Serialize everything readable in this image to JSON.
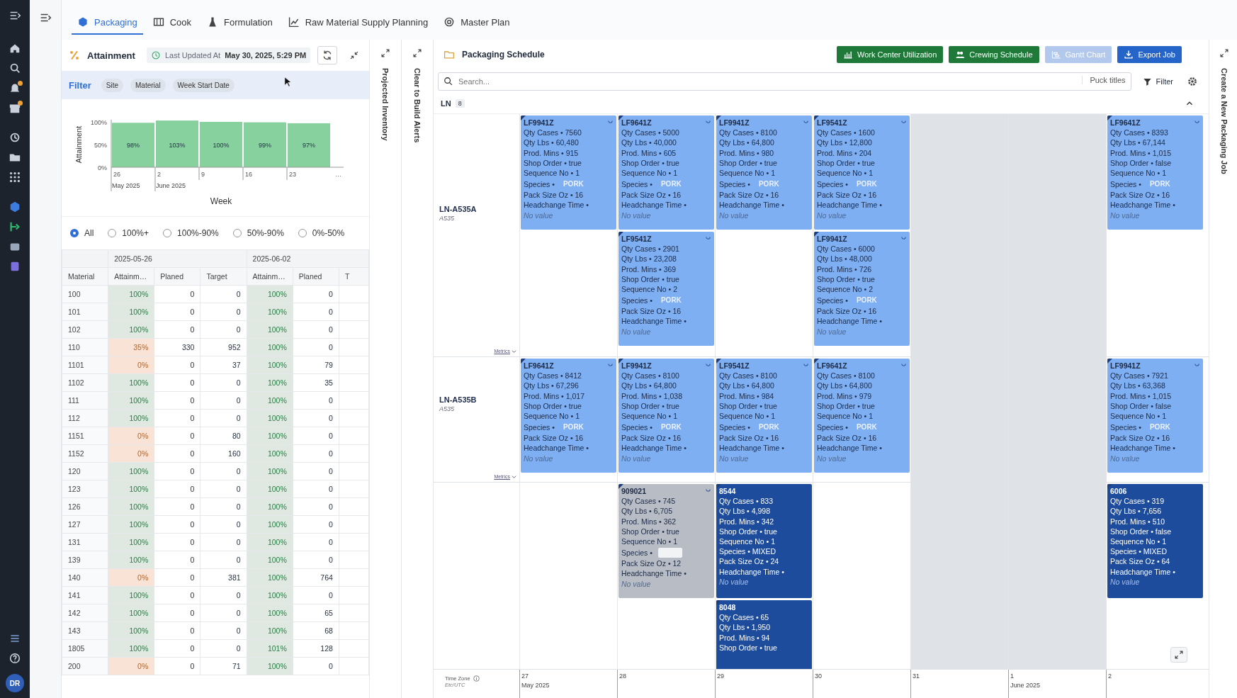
{
  "rail": [
    {
      "badge": false
    },
    {
      "badge": false
    },
    {
      "badge": false
    },
    {
      "badge": true
    },
    {
      "badge": true
    },
    {
      "badge": false
    },
    {
      "badge": false
    },
    {
      "badge": false
    },
    {
      "badge": false
    },
    {
      "badge": false
    },
    {
      "badge": false
    },
    {
      "badge": false
    }
  ],
  "avatar": "DR",
  "tabs": [
    {
      "label": "Packaging",
      "selected": true
    },
    {
      "label": "Cook",
      "selected": false
    },
    {
      "label": "Formulation",
      "selected": false
    },
    {
      "label": "Raw Material Supply Planning",
      "selected": false
    },
    {
      "label": "Master Plan",
      "selected": false
    }
  ],
  "attainment": {
    "title": "Attainment",
    "updated_label": "Last Updated At",
    "updated_value": "May 30, 2025, 5:29 PM",
    "filter": {
      "label": "Filter",
      "chips": [
        "Site",
        "Material",
        "Week Start Date"
      ]
    },
    "chart": {
      "month_labels": [
        "May 2025",
        "June 2025"
      ],
      "more_label": "…",
      "chart_data": {
        "type": "bar",
        "xlabel": "Week",
        "ylabel": "Attainment",
        "categories": [
          "26",
          "2",
          "9",
          "16",
          "23"
        ],
        "values": [
          98,
          103,
          100,
          99,
          97
        ],
        "ylim": [
          0,
          105
        ],
        "yticks": [
          {
            "value": 0,
            "label": "0%"
          },
          {
            "value": 50,
            "label": "50%"
          },
          {
            "value": 100,
            "label": "100%"
          }
        ],
        "data_labels": true,
        "value_labels": [
          "98%",
          "103%",
          "100%",
          "99%",
          "97%"
        ]
      }
    },
    "ranges": [
      {
        "label": "All",
        "selected": true
      },
      {
        "label": "100%+",
        "selected": false
      },
      {
        "label": "100%-90%",
        "selected": false
      },
      {
        "label": "50%-90%",
        "selected": false
      },
      {
        "label": "0%-50%",
        "selected": false
      }
    ],
    "table": {
      "week_headers": [
        "2025-05-26",
        "2025-06-02"
      ],
      "columns": [
        "Material",
        "Attainm…",
        "Planed",
        "Target",
        "Attainm…",
        "Planed",
        "T"
      ],
      "rows": [
        {
          "material": "100",
          "weeks": [
            {
              "attainment": "100%",
              "low": false,
              "planned": "0",
              "target": "0"
            },
            {
              "attainment": "100%",
              "low": false,
              "planned": "0"
            }
          ]
        },
        {
          "material": "101",
          "weeks": [
            {
              "attainment": "100%",
              "low": false,
              "planned": "0",
              "target": "0"
            },
            {
              "attainment": "100%",
              "low": false,
              "planned": "0"
            }
          ]
        },
        {
          "material": "102",
          "weeks": [
            {
              "attainment": "100%",
              "low": false,
              "planned": "0",
              "target": "0"
            },
            {
              "attainment": "100%",
              "low": false,
              "planned": "0"
            }
          ]
        },
        {
          "material": "110",
          "weeks": [
            {
              "attainment": "35%",
              "low": true,
              "planned": "330",
              "target": "952"
            },
            {
              "attainment": "100%",
              "low": false,
              "planned": "0"
            }
          ]
        },
        {
          "material": "1101",
          "weeks": [
            {
              "attainment": "0%",
              "low": true,
              "planned": "0",
              "target": "37"
            },
            {
              "attainment": "100%",
              "low": false,
              "planned": "79"
            }
          ]
        },
        {
          "material": "1102",
          "weeks": [
            {
              "attainment": "100%",
              "low": false,
              "planned": "0",
              "target": "0"
            },
            {
              "attainment": "100%",
              "low": false,
              "planned": "35"
            }
          ]
        },
        {
          "material": "111",
          "weeks": [
            {
              "attainment": "100%",
              "low": false,
              "planned": "0",
              "target": "0"
            },
            {
              "attainment": "100%",
              "low": false,
              "planned": "0"
            }
          ]
        },
        {
          "material": "112",
          "weeks": [
            {
              "attainment": "100%",
              "low": false,
              "planned": "0",
              "target": "0"
            },
            {
              "attainment": "100%",
              "low": false,
              "planned": "0"
            }
          ]
        },
        {
          "material": "1151",
          "weeks": [
            {
              "attainment": "0%",
              "low": true,
              "planned": "0",
              "target": "80"
            },
            {
              "attainment": "100%",
              "low": false,
              "planned": "0"
            }
          ]
        },
        {
          "material": "1152",
          "weeks": [
            {
              "attainment": "0%",
              "low": true,
              "planned": "0",
              "target": "160"
            },
            {
              "attainment": "100%",
              "low": false,
              "planned": "0"
            }
          ]
        },
        {
          "material": "120",
          "weeks": [
            {
              "attainment": "100%",
              "low": false,
              "planned": "0",
              "target": "0"
            },
            {
              "attainment": "100%",
              "low": false,
              "planned": "0"
            }
          ]
        },
        {
          "material": "123",
          "weeks": [
            {
              "attainment": "100%",
              "low": false,
              "planned": "0",
              "target": "0"
            },
            {
              "attainment": "100%",
              "low": false,
              "planned": "0"
            }
          ]
        },
        {
          "material": "126",
          "weeks": [
            {
              "attainment": "100%",
              "low": false,
              "planned": "0",
              "target": "0"
            },
            {
              "attainment": "100%",
              "low": false,
              "planned": "0"
            }
          ]
        },
        {
          "material": "127",
          "weeks": [
            {
              "attainment": "100%",
              "low": false,
              "planned": "0",
              "target": "0"
            },
            {
              "attainment": "100%",
              "low": false,
              "planned": "0"
            }
          ]
        },
        {
          "material": "131",
          "weeks": [
            {
              "attainment": "100%",
              "low": false,
              "planned": "0",
              "target": "0"
            },
            {
              "attainment": "100%",
              "low": false,
              "planned": "0"
            }
          ]
        },
        {
          "material": "139",
          "weeks": [
            {
              "attainment": "100%",
              "low": false,
              "planned": "0",
              "target": "0"
            },
            {
              "attainment": "100%",
              "low": false,
              "planned": "0"
            }
          ]
        },
        {
          "material": "140",
          "weeks": [
            {
              "attainment": "0%",
              "low": true,
              "planned": "0",
              "target": "381"
            },
            {
              "attainment": "100%",
              "low": false,
              "planned": "764"
            }
          ]
        },
        {
          "material": "141",
          "weeks": [
            {
              "attainment": "100%",
              "low": false,
              "planned": "0",
              "target": "0"
            },
            {
              "attainment": "100%",
              "low": false,
              "planned": "0"
            }
          ]
        },
        {
          "material": "142",
          "weeks": [
            {
              "attainment": "100%",
              "low": false,
              "planned": "0",
              "target": "0"
            },
            {
              "attainment": "100%",
              "low": false,
              "planned": "65"
            }
          ]
        },
        {
          "material": "143",
          "weeks": [
            {
              "attainment": "100%",
              "low": false,
              "planned": "0",
              "target": "0"
            },
            {
              "attainment": "100%",
              "low": false,
              "planned": "68"
            }
          ]
        },
        {
          "material": "1805",
          "weeks": [
            {
              "attainment": "100%",
              "low": false,
              "planned": "0",
              "target": "0"
            },
            {
              "attainment": "101%",
              "low": false,
              "planned": "128"
            }
          ]
        },
        {
          "material": "200",
          "weeks": [
            {
              "attainment": "0%",
              "low": true,
              "planned": "0",
              "target": "71"
            },
            {
              "attainment": "100%",
              "low": false,
              "planned": "0"
            }
          ]
        }
      ]
    }
  },
  "side_panels": [
    "Projected Inventory",
    "Clear to Build Alerts"
  ],
  "create_panel": "Create a New Packaging Job",
  "schedule": {
    "title": "Packaging Schedule",
    "buttons": [
      {
        "label": "Work Center Utilization",
        "kind": "green",
        "disabled": false
      },
      {
        "label": "Crewing Schedule",
        "kind": "green",
        "disabled": false
      },
      {
        "label": "Gantt Chart",
        "kind": "blue",
        "disabled": true
      },
      {
        "label": "Export Job",
        "kind": "blue",
        "disabled": false
      }
    ],
    "search": {
      "placeholder": "Search..."
    },
    "puck_titles": "Puck titles",
    "filter": "Filter",
    "group": {
      "label": "LN",
      "count": "8",
      "expanded": true
    },
    "lanes": [
      {
        "name": "LN-A535A",
        "code": "A535",
        "metrics": "Metrics",
        "columns": [
          {
            "nonworking": false,
            "cards": [
              {
                "kind": "light",
                "title": "LF9941Z",
                "fields": [
                  "Qty Cases • 7560",
                  "Qty Lbs • 60,480",
                  "Prod. Mins • 915",
                  "Shop Order • true",
                  "Sequence No • 1"
                ],
                "species": {
                  "label": "Species •",
                  "value": "PORK",
                  "tag": true
                },
                "pack_size": "Pack Size Oz • 16",
                "headchange": "Headchange Time •",
                "note": "No value"
              }
            ]
          },
          {
            "nonworking": false,
            "cards": [
              {
                "kind": "light",
                "title": "LF9641Z",
                "fields": [
                  "Qty Cases • 5000",
                  "Qty Lbs • 40,000",
                  "Prod. Mins • 605",
                  "Shop Order • true",
                  "Sequence No • 1"
                ],
                "species": {
                  "label": "Species •",
                  "value": "PORK",
                  "tag": true
                },
                "pack_size": "Pack Size Oz • 16",
                "headchange": "Headchange Time •",
                "note": "No value"
              },
              {
                "kind": "light",
                "title": "LF9541Z",
                "fields": [
                  "Qty Cases • 2901",
                  "Qty Lbs • 23,208",
                  "Prod. Mins • 369",
                  "Shop Order • true",
                  "Sequence No • 2"
                ],
                "species": {
                  "label": "Species •",
                  "value": "PORK",
                  "tag": true
                },
                "pack_size": "Pack Size Oz • 16",
                "headchange": "Headchange Time •",
                "note": "No value"
              }
            ]
          },
          {
            "nonworking": false,
            "cards": [
              {
                "kind": "light",
                "title": "LF9941Z",
                "fields": [
                  "Qty Cases • 8100",
                  "Qty Lbs • 64,800",
                  "Prod. Mins • 980",
                  "Shop Order • true",
                  "Sequence No • 1"
                ],
                "species": {
                  "label": "Species •",
                  "value": "PORK",
                  "tag": true
                },
                "pack_size": "Pack Size Oz • 16",
                "headchange": "Headchange Time •",
                "note": "No value"
              }
            ]
          },
          {
            "nonworking": false,
            "cards": [
              {
                "kind": "light",
                "title": "LF9541Z",
                "fields": [
                  "Qty Cases • 1600",
                  "Qty Lbs • 12,800",
                  "Prod. Mins • 204",
                  "Shop Order • true",
                  "Sequence No • 1"
                ],
                "species": {
                  "label": "Species •",
                  "value": "PORK",
                  "tag": true
                },
                "pack_size": "Pack Size Oz • 16",
                "headchange": "Headchange Time •",
                "note": "No value"
              },
              {
                "kind": "light",
                "title": "LF9941Z",
                "fields": [
                  "Qty Cases • 6000",
                  "Qty Lbs • 48,000",
                  "Prod. Mins • 726",
                  "Shop Order • true",
                  "Sequence No • 2"
                ],
                "species": {
                  "label": "Species •",
                  "value": "PORK",
                  "tag": true
                },
                "pack_size": "Pack Size Oz • 16",
                "headchange": "Headchange Time •",
                "note": "No value"
              }
            ]
          },
          {
            "nonworking": true
          },
          {
            "nonworking": true
          },
          {
            "nonworking": false,
            "cards": [
              {
                "kind": "light",
                "title": "LF9641Z",
                "fields": [
                  "Qty Cases • 8393",
                  "Qty Lbs • 67,144",
                  "Prod. Mins • 1,015",
                  "Shop Order • false",
                  "Sequence No • 1"
                ],
                "species": {
                  "label": "Species •",
                  "value": "PORK",
                  "tag": true
                },
                "pack_size": "Pack Size Oz • 16",
                "headchange": "Headchange Time •",
                "note": "No value"
              }
            ]
          }
        ]
      },
      {
        "name": "LN-A535B",
        "code": "A535",
        "metrics": "Metrics",
        "columns": [
          {
            "nonworking": false,
            "cards": [
              {
                "kind": "light",
                "title": "LF9641Z",
                "fields": [
                  "Qty Cases • 8412",
                  "Qty Lbs • 67,296",
                  "Prod. Mins • 1,017",
                  "Shop Order • true",
                  "Sequence No • 1"
                ],
                "species": {
                  "label": "Species •",
                  "value": "PORK",
                  "tag": true
                },
                "pack_size": "Pack Size Oz • 16",
                "headchange": "Headchange Time •",
                "note": "No value"
              }
            ]
          },
          {
            "nonworking": false,
            "cards": [
              {
                "kind": "light",
                "title": "LF9941Z",
                "fields": [
                  "Qty Cases • 8100",
                  "Qty Lbs • 64,800",
                  "Prod. Mins • 1,038",
                  "Shop Order • true",
                  "Sequence No • 1"
                ],
                "species": {
                  "label": "Species •",
                  "value": "PORK",
                  "tag": true
                },
                "pack_size": "Pack Size Oz • 16",
                "headchange": "Headchange Time •",
                "note": "No value"
              }
            ]
          },
          {
            "nonworking": false,
            "cards": [
              {
                "kind": "light",
                "title": "LF9541Z",
                "fields": [
                  "Qty Cases • 8100",
                  "Qty Lbs • 64,800",
                  "Prod. Mins • 984",
                  "Shop Order • true",
                  "Sequence No • 1"
                ],
                "species": {
                  "label": "Species •",
                  "value": "PORK",
                  "tag": true
                },
                "pack_size": "Pack Size Oz • 16",
                "headchange": "Headchange Time •",
                "note": "No value"
              }
            ]
          },
          {
            "nonworking": false,
            "cards": [
              {
                "kind": "light",
                "title": "LF9641Z",
                "fields": [
                  "Qty Cases • 8100",
                  "Qty Lbs • 64,800",
                  "Prod. Mins • 979",
                  "Shop Order • true",
                  "Sequence No • 1"
                ],
                "species": {
                  "label": "Species •",
                  "value": "PORK",
                  "tag": true
                },
                "pack_size": "Pack Size Oz • 16",
                "headchange": "Headchange Time •",
                "note": "No value"
              }
            ]
          },
          {
            "nonworking": true
          },
          {
            "nonworking": true
          },
          {
            "nonworking": false,
            "cards": [
              {
                "kind": "light",
                "title": "LF9941Z",
                "fields": [
                  "Qty Cases • 7921",
                  "Qty Lbs • 63,368",
                  "Prod. Mins • 1,015",
                  "Shop Order • false",
                  "Sequence No • 1"
                ],
                "species": {
                  "label": "Species •",
                  "value": "PORK",
                  "tag": true
                },
                "pack_size": "Pack Size Oz • 16",
                "headchange": "Headchange Time •",
                "note": "No value"
              }
            ]
          }
        ]
      },
      {
        "columns": [
          {
            "nonworking": false
          },
          {
            "nonworking": false,
            "cards": [
              {
                "kind": "grey",
                "title": "909021",
                "fields": [
                  "Qty Cases • 745",
                  "Qty Lbs • 6,705",
                  "Prod. Mins • 362",
                  "Shop Order • true",
                  "Sequence No • 1"
                ],
                "species": {
                  "label": "Species •",
                  "tag": true
                },
                "pack_size": "Pack Size Oz • 12",
                "headchange": "Headchange Time •",
                "note": "No value"
              }
            ]
          },
          {
            "nonworking": false,
            "cards": [
              {
                "kind": "dark",
                "title": "8544",
                "fields": [
                  "Qty Cases • 833",
                  "Qty Lbs • 4,998",
                  "Prod. Mins • 342",
                  "Shop Order • true",
                  "Sequence No • 1"
                ],
                "species": {
                  "label": "Species •",
                  "value": "MIXED",
                  "tag": false
                },
                "pack_size": "Pack Size Oz • 24",
                "headchange": "Headchange Time •",
                "note": "No value"
              },
              {
                "kind": "dark",
                "title": "8048",
                "fields": [
                  "Qty Cases • 65",
                  "Qty Lbs • 1,950",
                  "Prod. Mins • 94",
                  "Shop Order • true"
                ]
              }
            ]
          },
          {
            "nonworking": false
          },
          {
            "nonworking": true
          },
          {
            "nonworking": true
          },
          {
            "nonworking": false,
            "cards": [
              {
                "kind": "dark",
                "title": "6006",
                "fields": [
                  "Qty Cases • 319",
                  "Qty Lbs • 7,656",
                  "Prod. Mins • 510",
                  "Shop Order • false",
                  "Sequence No • 1"
                ],
                "species": {
                  "label": "Species •",
                  "value": "MIXED",
                  "tag": false
                },
                "pack_size": "Pack Size Oz • 64",
                "headchange": "Headchange Time •",
                "note": "No value"
              }
            ]
          }
        ]
      }
    ],
    "axis": {
      "timezone_label": "Time Zone",
      "timezone": "Etc/UTC",
      "days": [
        {
          "label": "27",
          "month": "May 2025"
        },
        {
          "label": "28"
        },
        {
          "label": "29"
        },
        {
          "label": "30"
        },
        {
          "label": "31"
        },
        {
          "label": "1",
          "month": "June 2025"
        },
        {
          "label": "2"
        }
      ]
    }
  }
}
